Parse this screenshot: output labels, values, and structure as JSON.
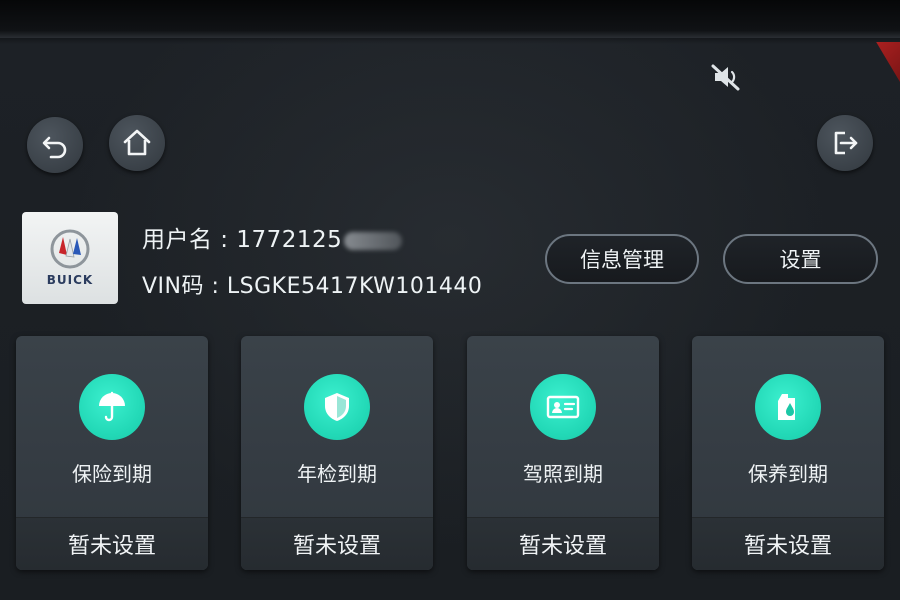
{
  "header": {
    "buttons": [
      {
        "id": "back",
        "icon": "back-arrow-icon"
      },
      {
        "id": "home",
        "icon": "home-icon"
      },
      {
        "id": "exit",
        "icon": "exit-icon"
      }
    ],
    "mute_icon": "mute-icon"
  },
  "profile": {
    "logo_text": "BUICK",
    "username_label": "用户名 : ",
    "username_value": "1772125",
    "vin_label": "VIN码 : ",
    "vin_value": "LSGKE5417KW101440"
  },
  "actions": {
    "info_manage_label": "信息管理",
    "settings_label": "设置"
  },
  "cards": [
    {
      "title": "保险到期",
      "status": "暂未设置",
      "icon": "umbrella-icon"
    },
    {
      "title": "年检到期",
      "status": "暂未设置",
      "icon": "shield-icon"
    },
    {
      "title": "驾照到期",
      "status": "暂未设置",
      "icon": "id-card-icon"
    },
    {
      "title": "保养到期",
      "status": "暂未设置",
      "icon": "oil-bottle-icon"
    }
  ],
  "colors": {
    "accent": "#22d8b6",
    "background": "#1a1e22",
    "card": "#373e45"
  }
}
